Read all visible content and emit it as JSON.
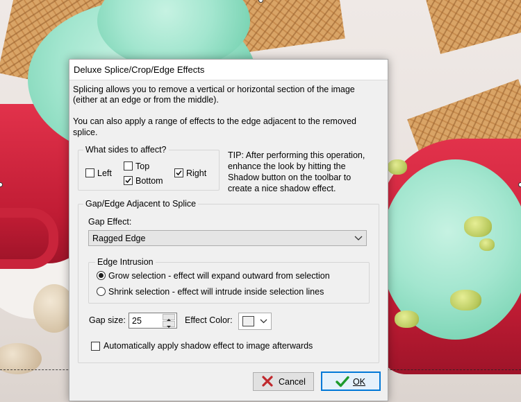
{
  "dialog": {
    "title": "Deluxe Splice/Crop/Edge Effects",
    "intro_line1": "Splicing allows you to remove a vertical or horizontal section of the image",
    "intro_line2": "(either at an edge or from the middle).",
    "intro_line3": "You can also apply a range of effects to the edge adjacent to the removed",
    "intro_line4": "splice."
  },
  "sides": {
    "legend": "What sides to affect?",
    "left": {
      "label": "Left",
      "checked": false
    },
    "top": {
      "label": "Top",
      "checked": false
    },
    "bottom": {
      "label": "Bottom",
      "checked": true
    },
    "right": {
      "label": "Right",
      "checked": true
    }
  },
  "tip": {
    "line1": "TIP: After performing this operation,",
    "line2": "enhance the look by hitting the",
    "line3": "Shadow button on the toolbar to",
    "line4": "create a nice shadow effect."
  },
  "gap_group": {
    "legend": "Gap/Edge Adjacent to Splice",
    "gap_effect_label": "Gap Effect:",
    "gap_effect_value": "Ragged Edge",
    "intrusion_legend": "Edge Intrusion",
    "grow_label": "Grow selection - effect will expand outward from selection",
    "shrink_label": "Shrink selection - effect will intrude inside selection lines",
    "selected_intrusion": "grow",
    "gap_size_label": "Gap size:",
    "gap_size_value": "25",
    "effect_color_label": "Effect Color:",
    "auto_shadow_label": "Automatically apply shadow effect to image afterwards",
    "auto_shadow_checked": false
  },
  "buttons": {
    "cancel": "Cancel",
    "ok": "OK"
  },
  "colors": {
    "ok_accent": "#0078d7",
    "cancel_icon": "#c0282d",
    "ok_icon": "#1d9a2c"
  }
}
